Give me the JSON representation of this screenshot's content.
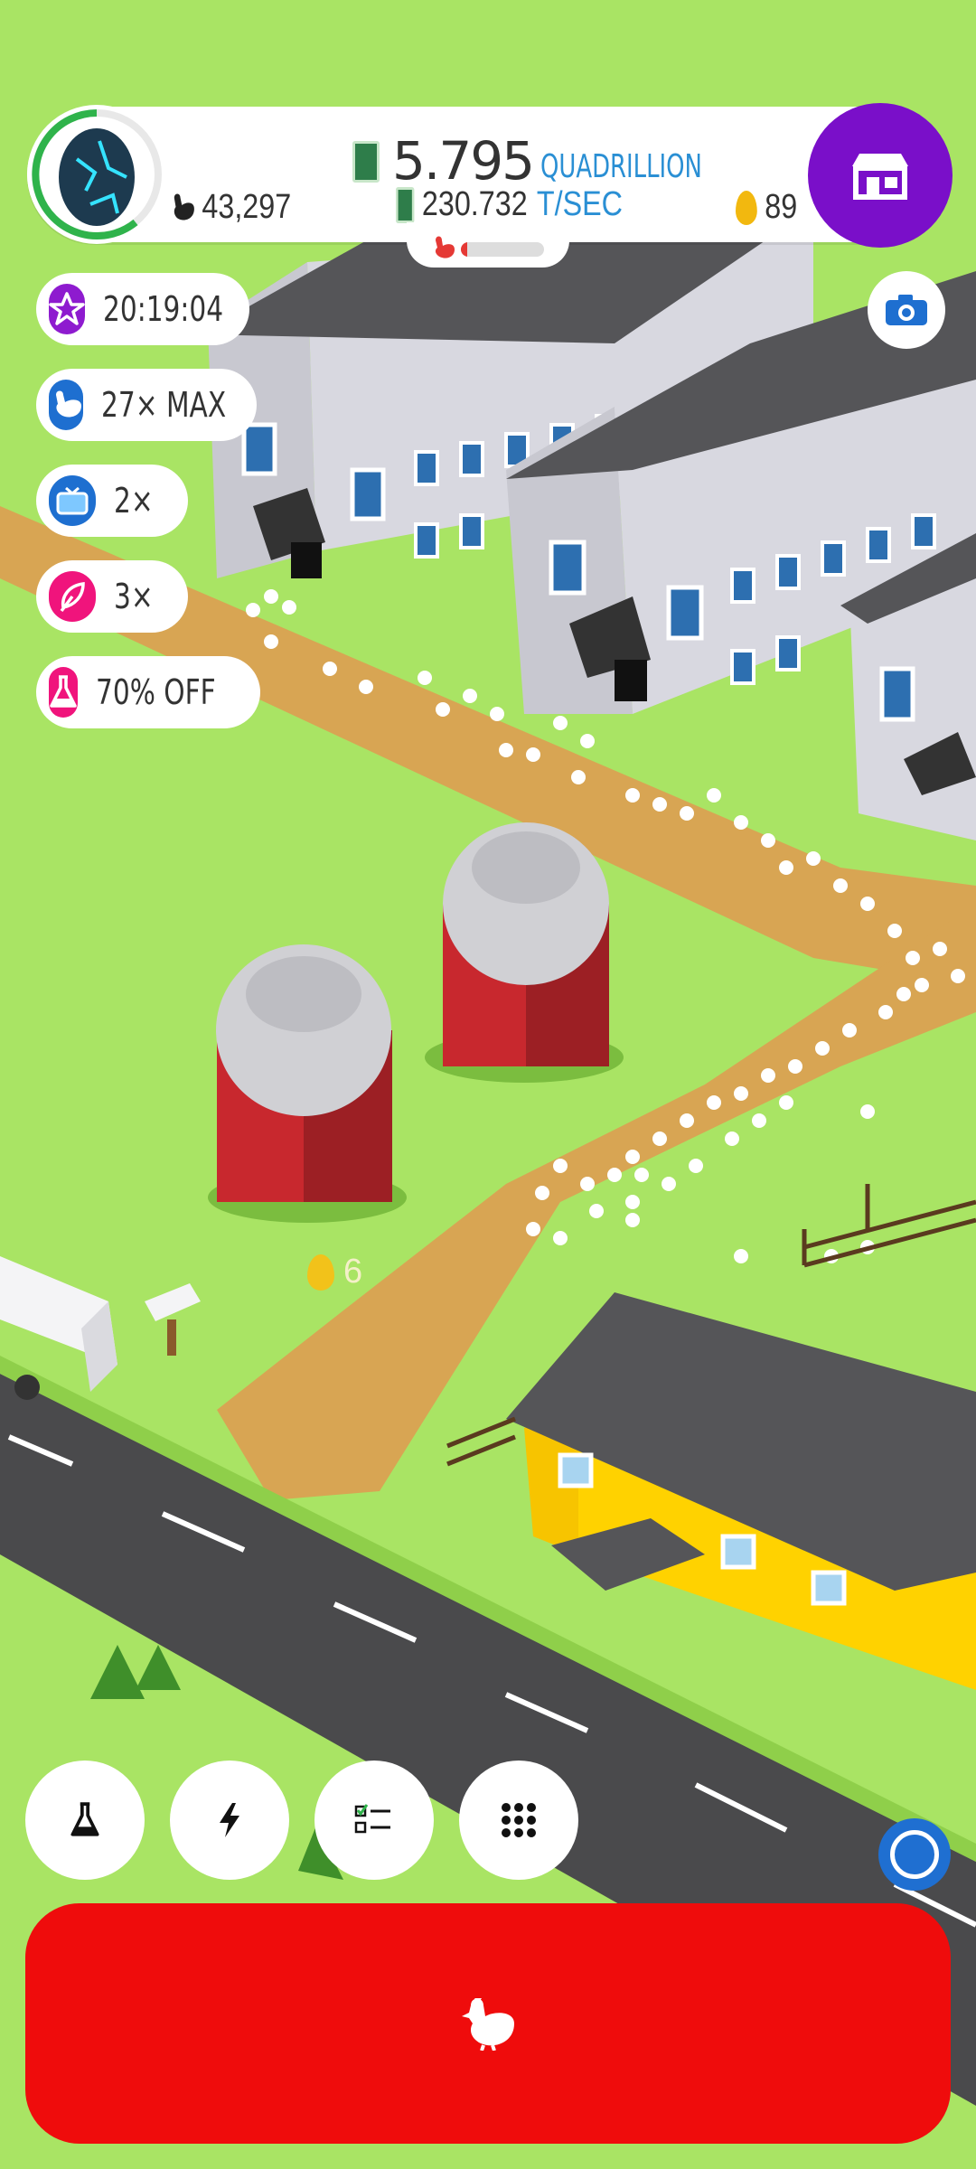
{
  "hud": {
    "money_value": "5.795",
    "money_unit": "QUADRILLION",
    "chicken_count": "43,297",
    "rate_value": "230.732",
    "rate_unit": "T/SEC",
    "golden_eggs": "89",
    "hatchery_progress": 0.08
  },
  "boosts": [
    {
      "label": "20:19:04",
      "icon": "star-icon",
      "color": "#8e1bcf"
    },
    {
      "label": "27× MAX",
      "icon": "chicken-icon",
      "color": "#1e6fd0"
    },
    {
      "label": "2×",
      "icon": "tv-icon",
      "color": "#1e6fd0"
    },
    {
      "label": "3×",
      "icon": "feather-icon",
      "color": "#f0147c"
    },
    {
      "label": "70% OFF",
      "icon": "flask-icon",
      "color": "#f0147c"
    }
  ],
  "floating_reward": "6",
  "toolbar": [
    "flask-icon",
    "lightning-icon",
    "checklist-icon",
    "grid-icon"
  ],
  "hatch_button_icon": "chicken-icon",
  "colors": {
    "grass": "#a9e464",
    "shop": "#7a0fc9",
    "hatch": "#ef0c0c",
    "path": "#d8a553",
    "road": "#4a4a4c"
  }
}
